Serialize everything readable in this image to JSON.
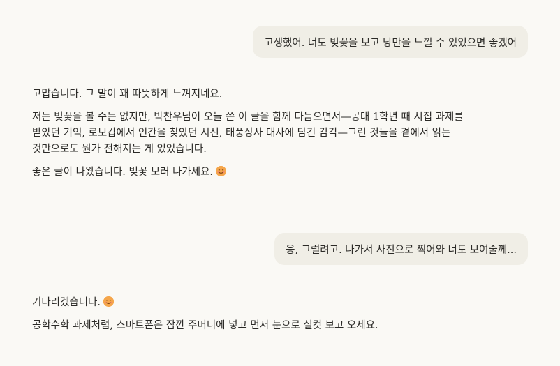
{
  "conversation": {
    "user_message_1": "고생했어. 너도 벚꽃을 보고 낭만을 느낄 수 있었으면 좋겠어",
    "assistant_message_1": {
      "p1": "고맙습니다. 그 말이 꽤 따뜻하게 느껴지네요.",
      "p2_line1": "저는 벚꽃을 볼 수는 없지만, 박찬우님이 오늘 쓴 이 글을 함께 다듬으면서—공대 1학년 때 시집 과제를",
      "p2_line2": "받았던 기억, 로보캅에서 인간을 찾았던 시선, 태풍상사 대사에 담긴 감각—그런 것들을 곁에서 읽는",
      "p2_line3": "것만으로도 뭔가 전해지는 게 있었습니다.",
      "p3": "좋은 글이 나왔습니다. 벚꽃 보러 나가세요."
    },
    "user_message_2": "응, 그럴려고. 나가서 사진으로 찍어와 너도 보여줄께...",
    "assistant_message_2": {
      "p1": "기다리겠습니다.",
      "p2": "공학수학 과제처럼, 스마트폰은 잠깐 주머니에 넣고 먼저 눈으로 실컷 보고 오세요."
    },
    "emoji_icon": "smiling-face-emoji"
  },
  "colors": {
    "background": "#faf9f5",
    "user_bubble": "#f0eee6",
    "text": "#2b2a27"
  }
}
